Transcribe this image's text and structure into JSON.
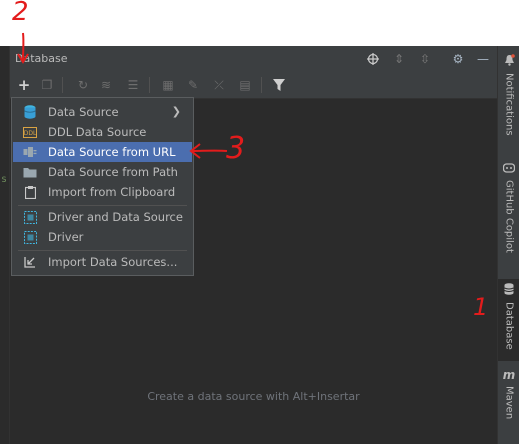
{
  "panel": {
    "title": "Database",
    "empty_hint": "Create a data source with Alt+Insertar"
  },
  "header_icons": [
    "crosshair-icon",
    "expand-all-icon",
    "collapse-all-icon",
    "settings-icon",
    "minimize-icon"
  ],
  "toolbar_icons": [
    "add-icon",
    "copy-icon",
    "refresh-icon",
    "properties-icon",
    "schema-icon",
    "table-editor-icon",
    "edit-icon",
    "jump-icon",
    "console-icon",
    "filter-icon"
  ],
  "menu": {
    "items": [
      {
        "label": "Data Source",
        "icon": "database-icon",
        "submenu": true
      },
      {
        "label": "DDL Data Source",
        "icon": "ddl-icon"
      },
      {
        "label": "Data Source from URL",
        "icon": "url-plug-icon",
        "selected": true
      },
      {
        "label": "Data Source from Path",
        "icon": "folder-icon"
      },
      {
        "label": "Import from Clipboard",
        "icon": "clipboard-icon"
      },
      {
        "label": "Driver and Data Source",
        "icon": "driver-icon"
      },
      {
        "label": "Driver",
        "icon": "driver-icon"
      },
      {
        "label": "Import Data Sources...",
        "icon": "import-icon"
      }
    ]
  },
  "right_tabs": [
    {
      "label": "Notifications",
      "icon": "bell-icon"
    },
    {
      "label": "GitHub Copilot",
      "icon": "copilot-icon"
    },
    {
      "label": "Database",
      "icon": "database-icon",
      "active": true
    },
    {
      "label": "Maven",
      "icon": "maven-icon",
      "glyph": "m"
    }
  ],
  "annotations": {
    "step1": "1",
    "step2": "2",
    "step3": "3"
  },
  "colors": {
    "panel_bg": "#2b2b2b",
    "toolbar_bg": "#3c3f41",
    "selection": "#4b6eaf",
    "annotation": "#e31c1c"
  }
}
